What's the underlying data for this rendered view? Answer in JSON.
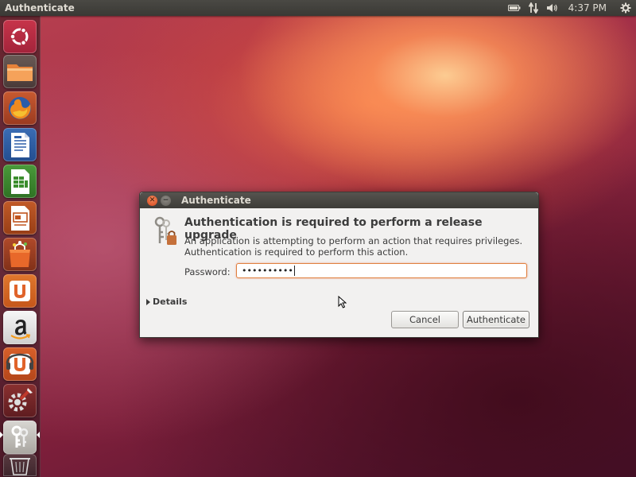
{
  "top_panel": {
    "app_title": "Authenticate",
    "clock": "4:37 PM",
    "tray_icons": [
      "battery-icon",
      "network-icon",
      "volume-icon",
      "gear-icon"
    ]
  },
  "launcher": {
    "items": [
      "ubuntu-dash",
      "files",
      "firefox",
      "libreoffice-writer",
      "libreoffice-calc",
      "libreoffice-impress",
      "software-center",
      "ubuntu-one",
      "amazon",
      "ubuntu-one-music",
      "system-settings",
      "authentication",
      "trash"
    ]
  },
  "dialog": {
    "title": "Authenticate",
    "heading": "Authentication is required to perform a release upgrade",
    "description_line1": "An application is attempting to perform an action that requires privileges.",
    "description_line2": "Authentication is required to perform this action.",
    "password_label": "Password:",
    "password_value": "••••••••••",
    "details_label": "Details",
    "cancel_label": "Cancel",
    "authenticate_label": "Authenticate"
  },
  "colors": {
    "accent": "#e95420",
    "panel": "#3c3b37"
  }
}
